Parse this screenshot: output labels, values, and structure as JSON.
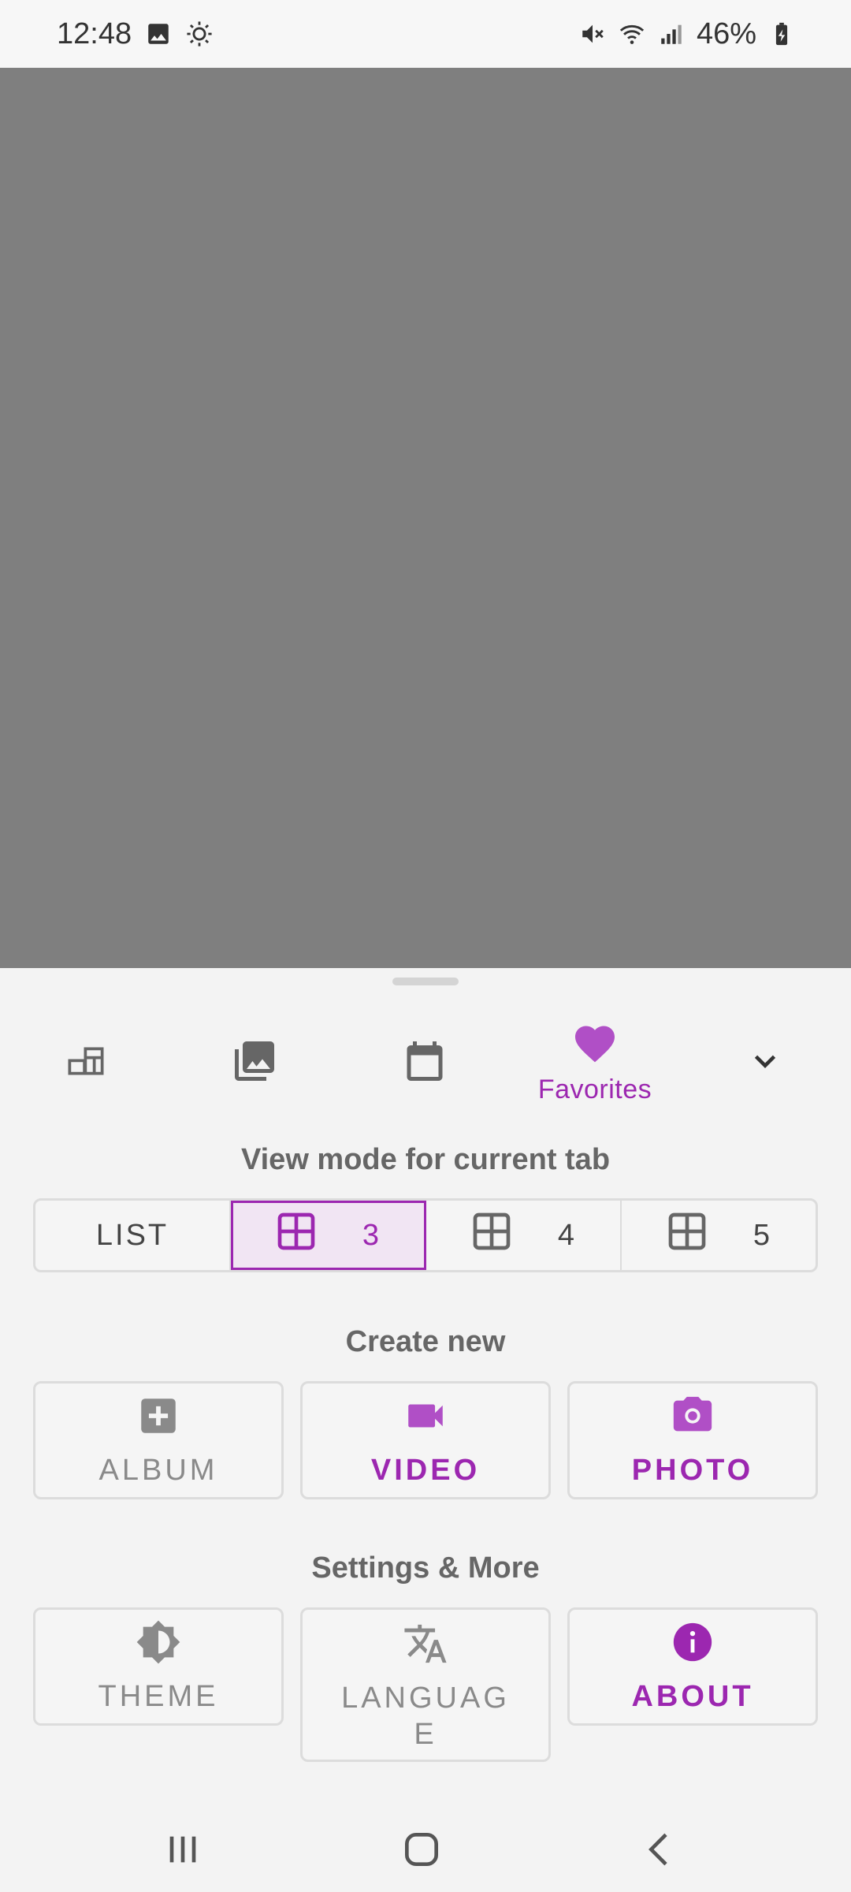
{
  "status_bar": {
    "time": "12:48",
    "battery": "46%",
    "icons": [
      "image-notification-icon",
      "brightness-icon",
      "mute-icon",
      "wifi-icon",
      "signal-icon",
      "battery-charging-icon"
    ]
  },
  "tabs": [
    {
      "icon": "dashboard-icon",
      "label": ""
    },
    {
      "icon": "photo-library-icon",
      "label": ""
    },
    {
      "icon": "calendar-icon",
      "label": ""
    },
    {
      "icon": "heart-icon",
      "label": "Favorites",
      "selected": true
    },
    {
      "icon": "chevron-down-icon",
      "label": ""
    }
  ],
  "view_mode": {
    "title": "View mode for current tab",
    "options": [
      {
        "label": "LIST",
        "selected": false
      },
      {
        "label": "3",
        "icon": "grid-icon",
        "selected": true
      },
      {
        "label": "4",
        "icon": "grid-icon",
        "selected": false
      },
      {
        "label": "5",
        "icon": "grid-icon",
        "selected": false
      }
    ]
  },
  "create_new": {
    "title": "Create new",
    "buttons": [
      {
        "label": "ALBUM",
        "icon": "add-box-icon",
        "enabled": false
      },
      {
        "label": "VIDEO",
        "icon": "videocam-icon",
        "enabled": true
      },
      {
        "label": "PHOTO",
        "icon": "camera-icon",
        "enabled": true
      }
    ]
  },
  "settings": {
    "title": "Settings & More",
    "buttons": [
      {
        "label": "THEME",
        "icon": "theme-icon",
        "enabled": false
      },
      {
        "label": "LANGUAGE",
        "icon": "translate-icon",
        "enabled": false
      },
      {
        "label": "ABOUT",
        "icon": "info-icon",
        "enabled": true
      }
    ]
  },
  "colors": {
    "accent": "#9c27b0",
    "scrim": "#7f7f7f",
    "sheet_bg": "#f3f3f3"
  }
}
